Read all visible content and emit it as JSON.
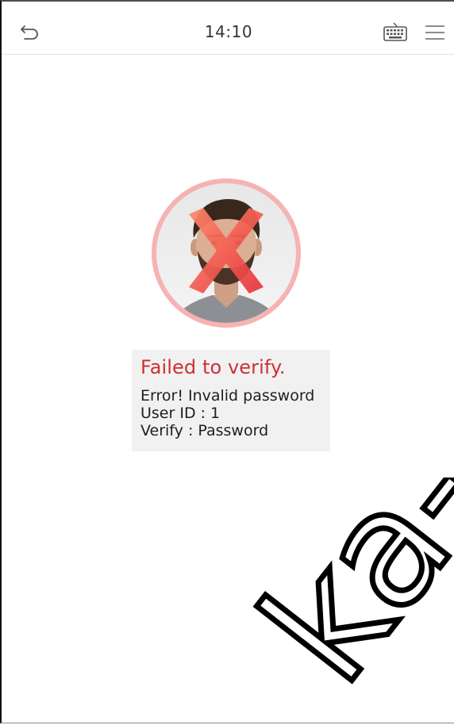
{
  "header": {
    "time": "14:10",
    "icons": {
      "back": "undo-arrow-icon",
      "keyboard": "keyboard-icon",
      "menu": "hamburger-menu-icon"
    }
  },
  "avatar": {
    "icon": "face-with-red-x-icon",
    "status_color": "#e53935"
  },
  "result": {
    "title": "Failed to verify.",
    "error": "Error! Invalid password",
    "user_id": "User ID : 1",
    "verify": "Verify : Password"
  },
  "watermark": {
    "text": "ka-sho"
  },
  "colors": {
    "error_red": "#cf2f33",
    "ring_pink": "#f2a3a3",
    "card_bg": "#f1f1f1",
    "watermark_black": "#000000"
  }
}
